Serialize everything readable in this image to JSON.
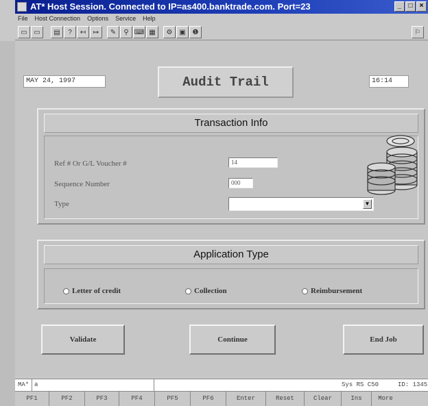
{
  "window": {
    "title": "AT* Host Session. Connected to IP=as400.banktrade.com. Port=23",
    "buttons": [
      "_",
      "□",
      "×"
    ]
  },
  "menu": [
    "File",
    "Host Connection",
    "Options",
    "Service",
    "Help"
  ],
  "toolbar": {
    "icons": [
      "connect-icon",
      "disconnect-icon",
      "print-icon",
      "help-icon",
      "send-icon",
      "receive-icon",
      "macro-icon",
      "zoom-icon",
      "keyboard-icon",
      "keypad-icon",
      "settings-icon",
      "window-icon",
      "info-icon"
    ],
    "right_icon": "help-icon"
  },
  "header": {
    "date": "MAY 24, 1997",
    "screen_title": "Audit Trail",
    "time": "16:14"
  },
  "transaction_info": {
    "heading": "Transaction Info",
    "ref_label": "Ref # Or G/L Voucher #",
    "ref_value": "14",
    "seq_label": "Sequence Number",
    "seq_value": "000",
    "type_label": "Type",
    "type_value": ""
  },
  "application_type": {
    "heading": "Application Type",
    "options": [
      "Letter of credit",
      "Collection",
      "Reimbursement"
    ]
  },
  "actions": {
    "validate": "Validate",
    "continue": "Continue",
    "end_job": "End Job"
  },
  "status": {
    "mode": "MA*",
    "cursor": "a",
    "session": "Sys RS C50",
    "id": "ID: 1345"
  },
  "pf_keys": [
    "PF1",
    "PF2",
    "PF3",
    "PF4",
    "PF5",
    "PF6",
    "Enter",
    "Reset",
    "Clear",
    "Ins",
    "More"
  ]
}
